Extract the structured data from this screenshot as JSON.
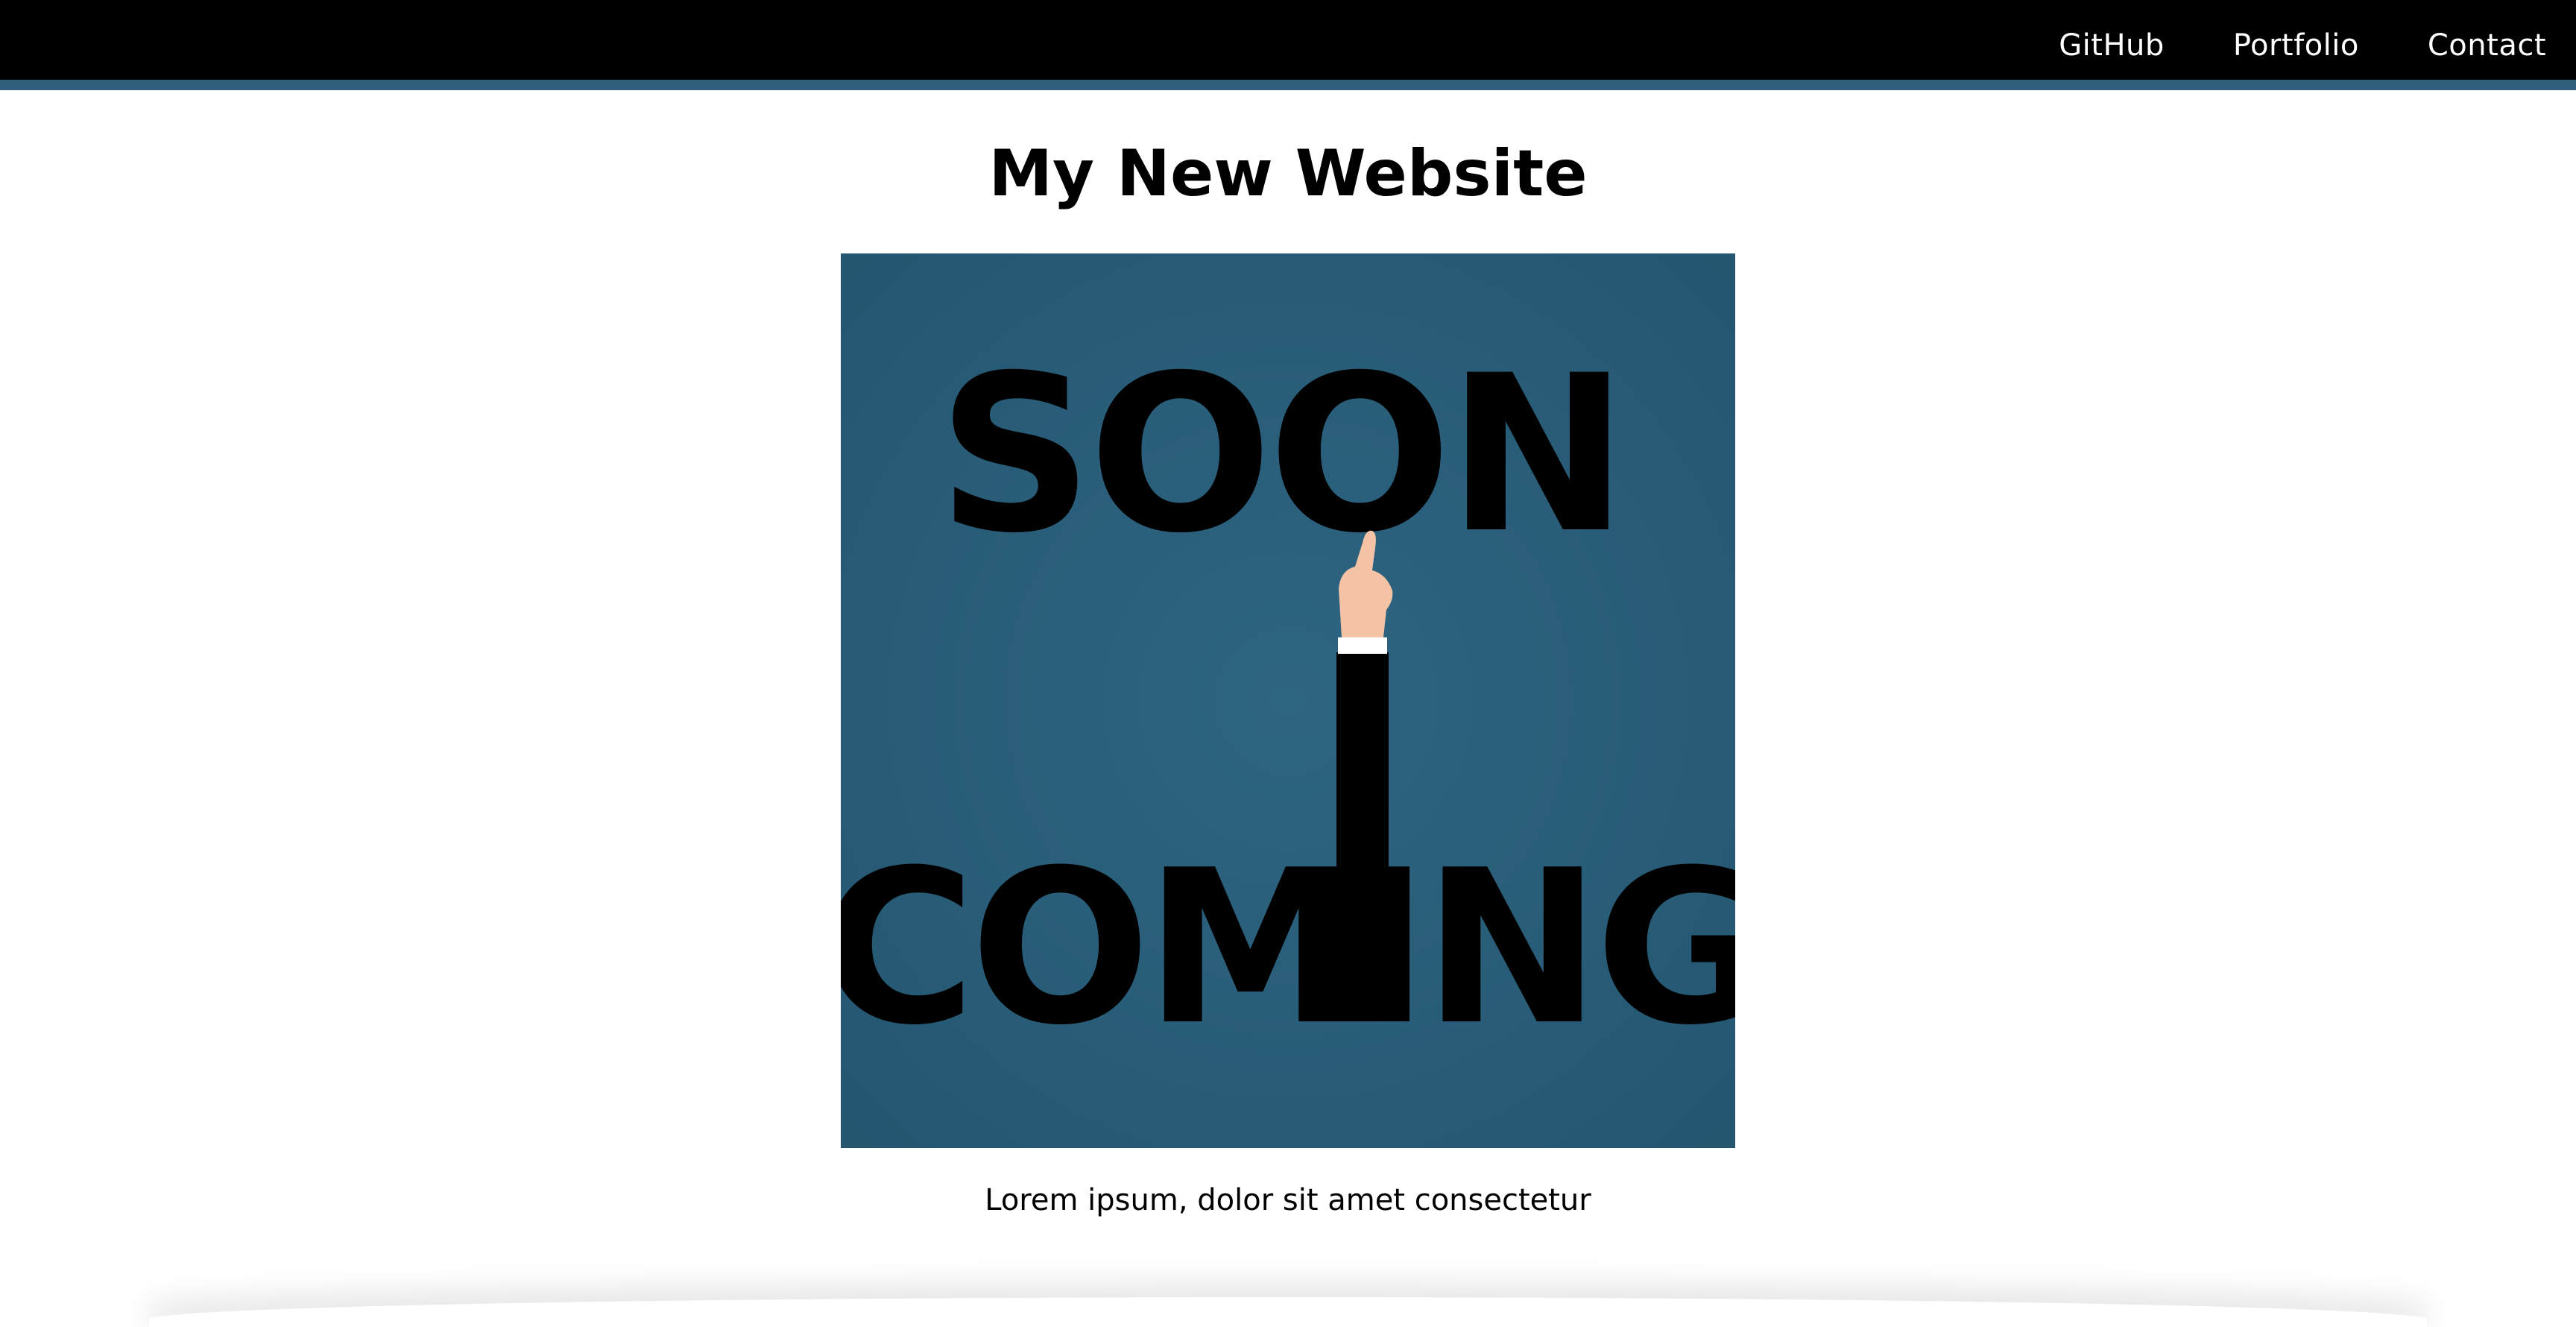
{
  "nav": {
    "links": [
      {
        "label": "GitHub"
      },
      {
        "label": "Portfolio"
      },
      {
        "label": "Contact"
      }
    ]
  },
  "header": {
    "title": "My New Website"
  },
  "hero": {
    "image_name": "coming-soon-illustration",
    "text_top": "SOON",
    "text_bottom": "COMING",
    "background_color": "#2b5f7a"
  },
  "content": {
    "caption": "Lorem ipsum, dolor sit amet consectetur"
  },
  "colors": {
    "navbar": "#000000",
    "navbar_accent": "#2f5f7c",
    "page_background": "#ffffff",
    "text": "#000000"
  }
}
